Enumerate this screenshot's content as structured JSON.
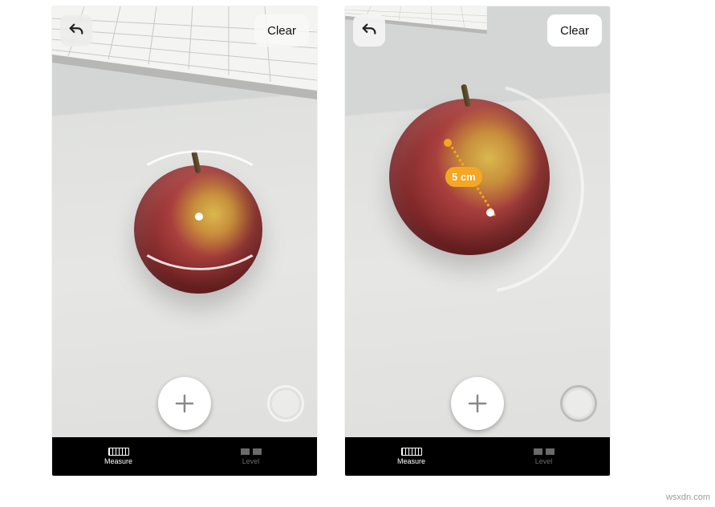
{
  "controls": {
    "clear_label": "Clear",
    "add_label": "+",
    "undo_icon": "undo-icon",
    "shutter_icon": "shutter-icon"
  },
  "tabs": {
    "measure": "Measure",
    "level": "Level"
  },
  "measurement": {
    "value": "5 cm"
  },
  "watermark": "wsxdn.com"
}
